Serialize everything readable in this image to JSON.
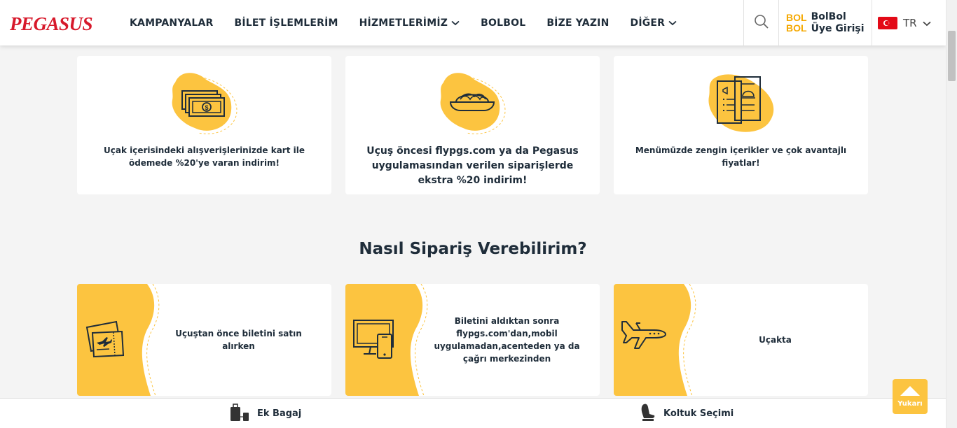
{
  "header": {
    "logo": "PEGASUS",
    "nav": [
      {
        "label": "KAMPANYALAR",
        "dropdown": false
      },
      {
        "label": "BİLET İŞLEMLERİM",
        "dropdown": false
      },
      {
        "label": "HİZMETLERİMİZ",
        "dropdown": true
      },
      {
        "label": "BOLBOL",
        "dropdown": false
      },
      {
        "label": "BİZE YAZIN",
        "dropdown": false
      },
      {
        "label": "DİĞER",
        "dropdown": true
      }
    ],
    "bolbol_logo_line1": "BOL",
    "bolbol_logo_line2": "BOL",
    "bolbol_line1": "BolBol",
    "bolbol_line2": "Üye Girişi",
    "language": "TR"
  },
  "benefits": [
    {
      "text": "Uçak içerisindeki alışverişlerinizde kart ile ödemede %20'ye varan indirim!",
      "icon": "money-icon"
    },
    {
      "text": "Uçuş öncesi flypgs.com ya da Pegasus uygulamasından verilen siparişlerde ekstra %20 indirim!",
      "icon": "food-plate-icon"
    },
    {
      "text": "Menümüzde zengin içerikler ve çok avantajlı fiyatlar!",
      "icon": "menu-icon"
    }
  ],
  "section_title": "Nasıl Sipariş Verebilirim?",
  "steps": [
    {
      "text": "Uçuştan önce biletini satın alırken",
      "icon": "ticket-icon"
    },
    {
      "text": "Biletini aldıktan sonra flypgs.com'dan,mobil uygulamadan,acenteden ya da çağrı merkezinden",
      "icon": "devices-icon"
    },
    {
      "text": "Uçakta",
      "icon": "airplane-icon"
    }
  ],
  "scroll_top_label": "Yukarı",
  "bottom_bar": {
    "extra_baggage": "Ek Bagaj",
    "seat_selection": "Koltuk Seçimi"
  },
  "colors": {
    "accent_yellow": "#fcc440",
    "brand_red": "#d7192b",
    "text_dark": "#1f2d3a"
  }
}
